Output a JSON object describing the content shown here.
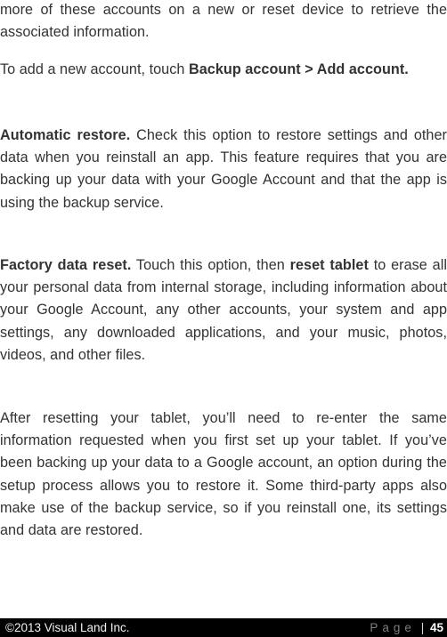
{
  "document": {
    "paragraphs": [
      {
        "segments": [
          {
            "text": "more of these accounts on a new or reset device to retrieve the associated information.",
            "bold": false
          }
        ]
      },
      {
        "segments": [
          {
            "text": "To add a new account, touch ",
            "bold": false
          },
          {
            "text": "Backup account > Add account.",
            "bold": true
          }
        ]
      },
      {
        "segments": [
          {
            "text": "Automatic restore.",
            "bold": true
          },
          {
            "text": " Check this option to restore settings and other data when you reinstall an app. This feature requires that you are backing up your data with your Google Account and that the app is using the backup service.",
            "bold": false
          }
        ]
      },
      {
        "segments": [
          {
            "text": "Factory data reset.",
            "bold": true
          },
          {
            "text": " Touch this option, then ",
            "bold": false
          },
          {
            "text": "reset tablet",
            "bold": true
          },
          {
            "text": " to erase all your personal data from internal storage, including information about your Google Account, any other accounts, your system and app settings, any downloaded applications, and your music, photos, videos, and other files.",
            "bold": false
          }
        ]
      },
      {
        "segments": [
          {
            "text": "After resetting your tablet, you’ll need to re-enter the same information requested when you first set up your tablet. If you’ve been backing up your data to a Google account, an option during the setup process allows you to restore it. Some third-party apps also make use of the backup service, so if you reinstall one, its settings and data are restored.",
            "bold": false
          }
        ]
      }
    ]
  },
  "footer": {
    "copyright": "©2013 Visual Land Inc.",
    "page_label": "Page",
    "separator": "|",
    "page_number": "45"
  },
  "colors": {
    "text": "#333333",
    "footer_bg": "#000000",
    "footer_text": "#ffffff",
    "page_label": "#7f7f7f"
  }
}
